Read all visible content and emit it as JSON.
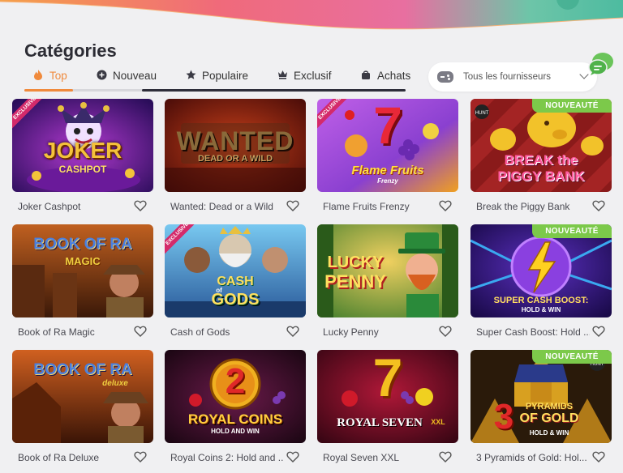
{
  "page": {
    "title": "Catégories"
  },
  "tabs": [
    {
      "label": "Top",
      "icon": "flame-icon",
      "active": true
    },
    {
      "label": "Nouveau",
      "icon": "plus-circle-icon",
      "active": false
    },
    {
      "label": "Populaire",
      "icon": "star-icon",
      "active": false
    },
    {
      "label": "Exclusif",
      "icon": "crown-icon",
      "active": false
    },
    {
      "label": "Achats",
      "icon": "bag-icon",
      "active": false
    }
  ],
  "provider": {
    "label": "Tous les fournisseurs",
    "icon": "gamepad-icon"
  },
  "badges": {
    "new": "NOUVEAUTÉ",
    "exclusive": "EXCLUSIVE"
  },
  "colors": {
    "accent": "#f08a3c",
    "new_badge": "#7cc94a",
    "exclusive_badge": "#d42a6a"
  },
  "games": [
    {
      "name": "Joker Cashpot",
      "art": [
        "JOKER",
        "CASHPOT"
      ],
      "exclusive": true,
      "new": false
    },
    {
      "name": "Wanted: Dead or a Wild",
      "art": [
        "WANTED",
        "DEAD OR A WILD"
      ],
      "exclusive": false,
      "new": false
    },
    {
      "name": "Flame Fruits Frenzy",
      "art": [
        "7",
        "Flame Fruits",
        "Frenzy"
      ],
      "exclusive": true,
      "new": false
    },
    {
      "name": "Break the Piggy Bank",
      "art": [
        "BREAK the",
        "PIGGY BANK"
      ],
      "exclusive": false,
      "new": true
    },
    {
      "name": "Book of Ra Magic",
      "art": [
        "BOOK OF RA",
        "MAGIC"
      ],
      "exclusive": false,
      "new": false
    },
    {
      "name": "Cash of Gods",
      "art": [
        "CASH",
        "GODS",
        "of"
      ],
      "exclusive": true,
      "new": false
    },
    {
      "name": "Lucky Penny",
      "art": [
        "LUCKY",
        "PENNY"
      ],
      "exclusive": false,
      "new": false
    },
    {
      "name": "Super Cash Boost: Hold ...",
      "art": [
        "SUPER CASH BOOST:",
        "HOLD & WIN"
      ],
      "exclusive": false,
      "new": true
    },
    {
      "name": "Book of Ra Deluxe",
      "art": [
        "BOOK OF RA",
        "deluxe"
      ],
      "exclusive": false,
      "new": false
    },
    {
      "name": "Royal Coins 2: Hold and ...",
      "art": [
        "2",
        "ROYAL COINS",
        "HOLD AND WIN"
      ],
      "exclusive": false,
      "new": false
    },
    {
      "name": "Royal Seven XXL",
      "art": [
        "7",
        "ROYAL SEVEN",
        "XXL"
      ],
      "exclusive": false,
      "new": false
    },
    {
      "name": "3 Pyramids of Gold: Hol...",
      "art": [
        "3",
        "PYRAMIDS",
        "OF GOLD",
        "HOLD & WIN"
      ],
      "exclusive": false,
      "new": true
    }
  ]
}
